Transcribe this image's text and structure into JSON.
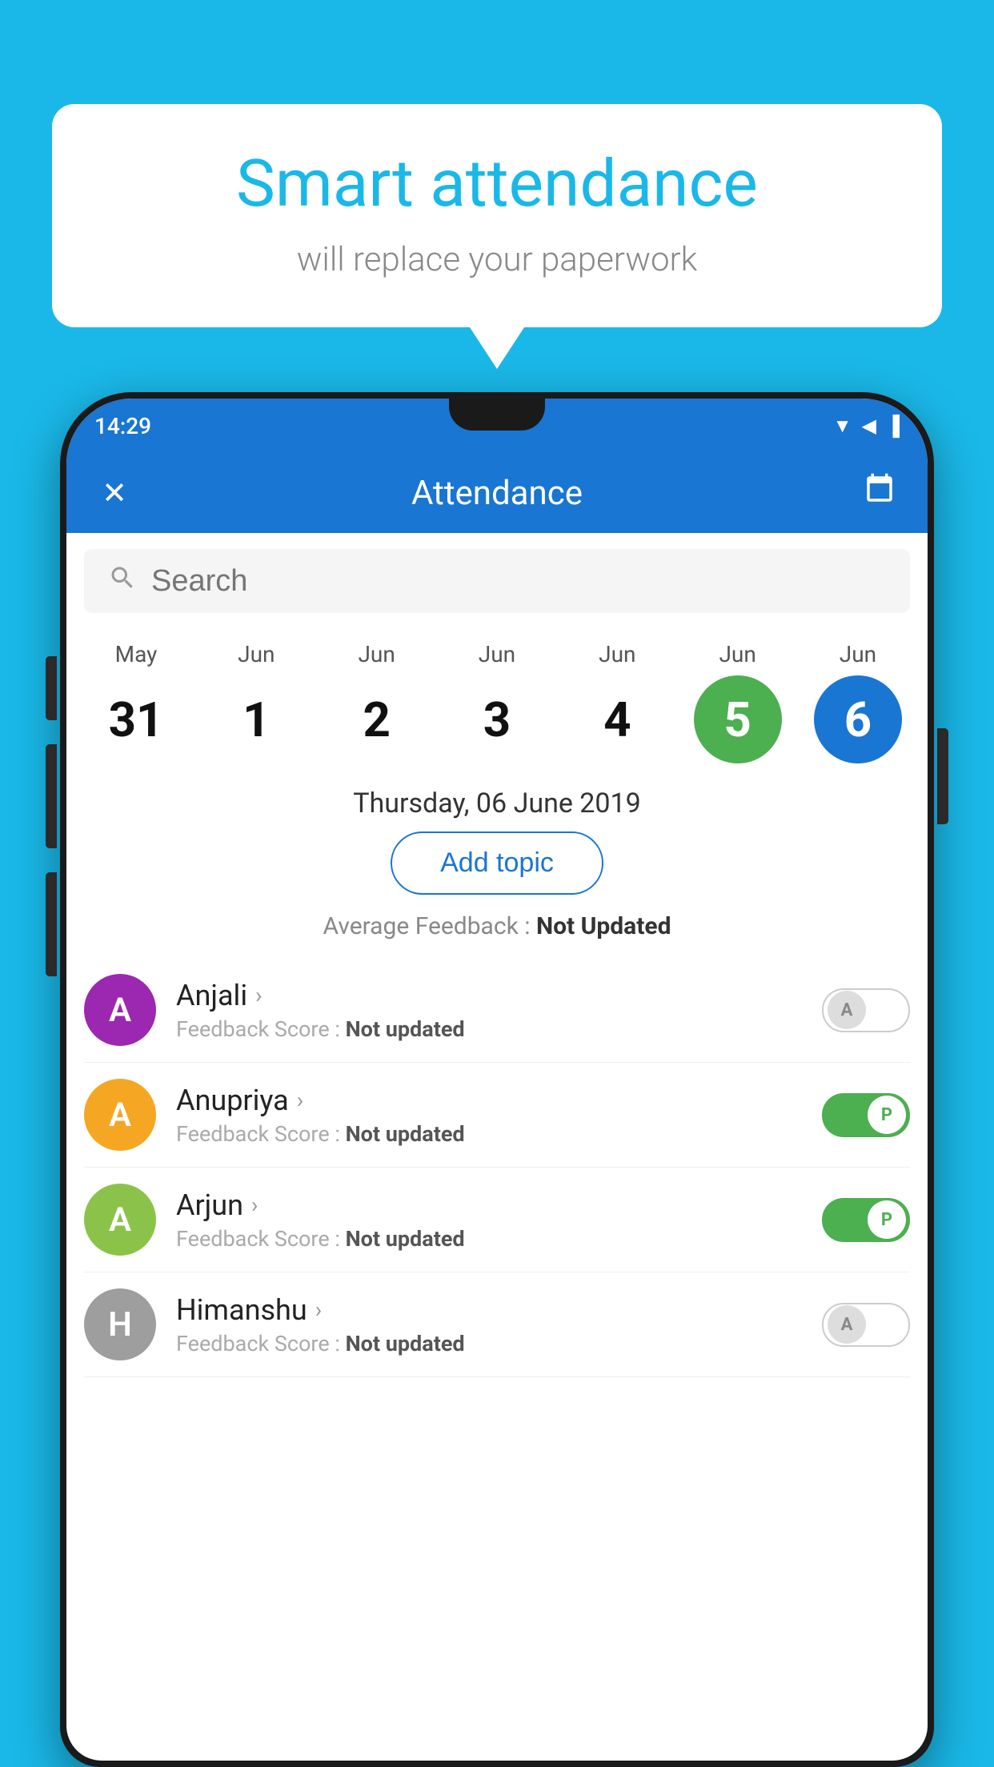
{
  "background_color": "#1ab8e8",
  "bubble": {
    "title": "Smart attendance",
    "subtitle": "will replace your paperwork"
  },
  "status_bar": {
    "time": "14:29",
    "icons": "▼◀█"
  },
  "app_bar": {
    "title": "Attendance",
    "close_label": "✕",
    "calendar_label": "📅"
  },
  "search": {
    "placeholder": "Search"
  },
  "calendar": {
    "days": [
      {
        "month": "May",
        "number": "31",
        "state": "normal"
      },
      {
        "month": "Jun",
        "number": "1",
        "state": "normal"
      },
      {
        "month": "Jun",
        "number": "2",
        "state": "normal"
      },
      {
        "month": "Jun",
        "number": "3",
        "state": "normal"
      },
      {
        "month": "Jun",
        "number": "4",
        "state": "normal"
      },
      {
        "month": "Jun",
        "number": "5",
        "state": "today"
      },
      {
        "month": "Jun",
        "number": "6",
        "state": "selected"
      }
    ]
  },
  "date_heading": "Thursday, 06 June 2019",
  "add_topic_label": "Add topic",
  "avg_feedback_label": "Average Feedback : ",
  "avg_feedback_value": "Not Updated",
  "students": [
    {
      "name": "Anjali",
      "feedback_label": "Feedback Score : ",
      "feedback_value": "Not updated",
      "avatar_letter": "A",
      "avatar_color": "#9c27b0",
      "toggle_state": "off",
      "toggle_label": "A"
    },
    {
      "name": "Anupriya",
      "feedback_label": "Feedback Score : ",
      "feedback_value": "Not updated",
      "avatar_letter": "A",
      "avatar_color": "#f5a623",
      "toggle_state": "on",
      "toggle_label": "P"
    },
    {
      "name": "Arjun",
      "feedback_label": "Feedback Score : ",
      "feedback_value": "Not updated",
      "avatar_letter": "A",
      "avatar_color": "#8bc34a",
      "toggle_state": "on",
      "toggle_label": "P"
    },
    {
      "name": "Himanshu",
      "feedback_label": "Feedback Score : ",
      "feedback_value": "Not updated",
      "avatar_letter": "H",
      "avatar_color": "#9e9e9e",
      "toggle_state": "off",
      "toggle_label": "A"
    }
  ]
}
